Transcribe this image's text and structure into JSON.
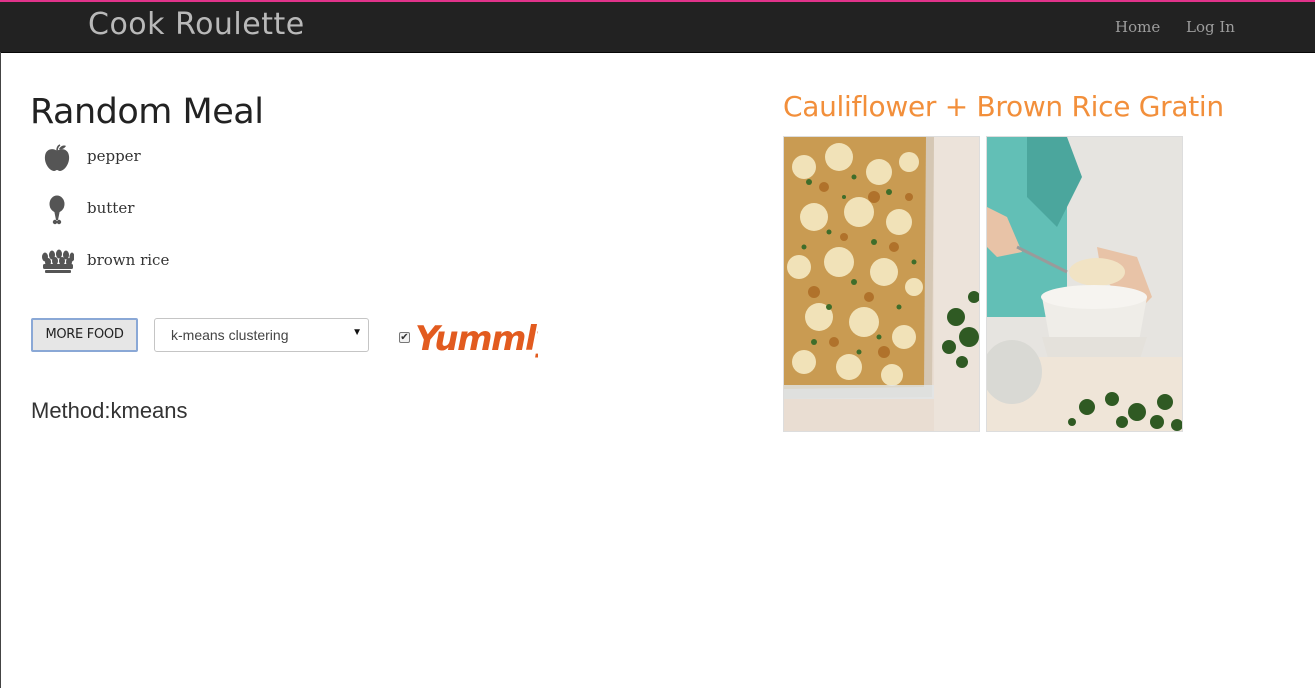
{
  "colors": {
    "navbar": "#222222",
    "brand_text": "#b9b9b9",
    "nav_link": "#9d9d9d",
    "accent_line": "#e0338a",
    "recipe_title": "#f28f3b",
    "yummly": "#e25b1f"
  },
  "navbar": {
    "brand": "Cook Roulette",
    "links": [
      {
        "label": "Home"
      },
      {
        "label": "Log In"
      }
    ]
  },
  "main": {
    "title": "Random Meal",
    "ingredients": [
      {
        "icon": "apple-icon",
        "label": "pepper"
      },
      {
        "icon": "drumstick-icon",
        "label": "butter"
      },
      {
        "icon": "grain-icon",
        "label": "brown rice"
      }
    ],
    "controls": {
      "more_food_label": "MORE FOOD",
      "method_select": {
        "selected": "k-means clustering"
      },
      "yummly_checked": true,
      "yummly_logo_text": "Yummly"
    },
    "method": {
      "label": "Method:",
      "value": "kmeans"
    }
  },
  "recipe": {
    "title": "Cauliflower + Brown Rice Gratin",
    "photos": [
      {
        "icon": "gratin-dish-photo"
      },
      {
        "icon": "serving-bowl-photo"
      }
    ]
  }
}
